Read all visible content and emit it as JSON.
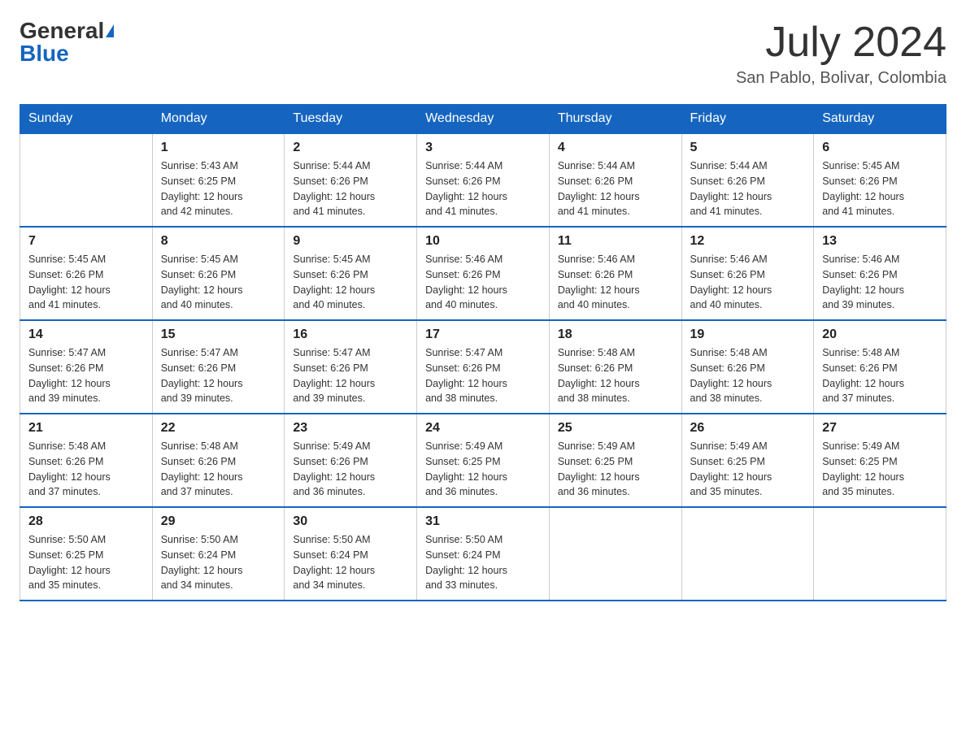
{
  "header": {
    "logo_general": "General",
    "logo_blue": "Blue",
    "month_year": "July 2024",
    "location": "San Pablo, Bolivar, Colombia"
  },
  "days_of_week": [
    "Sunday",
    "Monday",
    "Tuesday",
    "Wednesday",
    "Thursday",
    "Friday",
    "Saturday"
  ],
  "weeks": [
    [
      {
        "day": "",
        "info": ""
      },
      {
        "day": "1",
        "info": "Sunrise: 5:43 AM\nSunset: 6:25 PM\nDaylight: 12 hours\nand 42 minutes."
      },
      {
        "day": "2",
        "info": "Sunrise: 5:44 AM\nSunset: 6:26 PM\nDaylight: 12 hours\nand 41 minutes."
      },
      {
        "day": "3",
        "info": "Sunrise: 5:44 AM\nSunset: 6:26 PM\nDaylight: 12 hours\nand 41 minutes."
      },
      {
        "day": "4",
        "info": "Sunrise: 5:44 AM\nSunset: 6:26 PM\nDaylight: 12 hours\nand 41 minutes."
      },
      {
        "day": "5",
        "info": "Sunrise: 5:44 AM\nSunset: 6:26 PM\nDaylight: 12 hours\nand 41 minutes."
      },
      {
        "day": "6",
        "info": "Sunrise: 5:45 AM\nSunset: 6:26 PM\nDaylight: 12 hours\nand 41 minutes."
      }
    ],
    [
      {
        "day": "7",
        "info": "Sunrise: 5:45 AM\nSunset: 6:26 PM\nDaylight: 12 hours\nand 41 minutes."
      },
      {
        "day": "8",
        "info": "Sunrise: 5:45 AM\nSunset: 6:26 PM\nDaylight: 12 hours\nand 40 minutes."
      },
      {
        "day": "9",
        "info": "Sunrise: 5:45 AM\nSunset: 6:26 PM\nDaylight: 12 hours\nand 40 minutes."
      },
      {
        "day": "10",
        "info": "Sunrise: 5:46 AM\nSunset: 6:26 PM\nDaylight: 12 hours\nand 40 minutes."
      },
      {
        "day": "11",
        "info": "Sunrise: 5:46 AM\nSunset: 6:26 PM\nDaylight: 12 hours\nand 40 minutes."
      },
      {
        "day": "12",
        "info": "Sunrise: 5:46 AM\nSunset: 6:26 PM\nDaylight: 12 hours\nand 40 minutes."
      },
      {
        "day": "13",
        "info": "Sunrise: 5:46 AM\nSunset: 6:26 PM\nDaylight: 12 hours\nand 39 minutes."
      }
    ],
    [
      {
        "day": "14",
        "info": "Sunrise: 5:47 AM\nSunset: 6:26 PM\nDaylight: 12 hours\nand 39 minutes."
      },
      {
        "day": "15",
        "info": "Sunrise: 5:47 AM\nSunset: 6:26 PM\nDaylight: 12 hours\nand 39 minutes."
      },
      {
        "day": "16",
        "info": "Sunrise: 5:47 AM\nSunset: 6:26 PM\nDaylight: 12 hours\nand 39 minutes."
      },
      {
        "day": "17",
        "info": "Sunrise: 5:47 AM\nSunset: 6:26 PM\nDaylight: 12 hours\nand 38 minutes."
      },
      {
        "day": "18",
        "info": "Sunrise: 5:48 AM\nSunset: 6:26 PM\nDaylight: 12 hours\nand 38 minutes."
      },
      {
        "day": "19",
        "info": "Sunrise: 5:48 AM\nSunset: 6:26 PM\nDaylight: 12 hours\nand 38 minutes."
      },
      {
        "day": "20",
        "info": "Sunrise: 5:48 AM\nSunset: 6:26 PM\nDaylight: 12 hours\nand 37 minutes."
      }
    ],
    [
      {
        "day": "21",
        "info": "Sunrise: 5:48 AM\nSunset: 6:26 PM\nDaylight: 12 hours\nand 37 minutes."
      },
      {
        "day": "22",
        "info": "Sunrise: 5:48 AM\nSunset: 6:26 PM\nDaylight: 12 hours\nand 37 minutes."
      },
      {
        "day": "23",
        "info": "Sunrise: 5:49 AM\nSunset: 6:26 PM\nDaylight: 12 hours\nand 36 minutes."
      },
      {
        "day": "24",
        "info": "Sunrise: 5:49 AM\nSunset: 6:25 PM\nDaylight: 12 hours\nand 36 minutes."
      },
      {
        "day": "25",
        "info": "Sunrise: 5:49 AM\nSunset: 6:25 PM\nDaylight: 12 hours\nand 36 minutes."
      },
      {
        "day": "26",
        "info": "Sunrise: 5:49 AM\nSunset: 6:25 PM\nDaylight: 12 hours\nand 35 minutes."
      },
      {
        "day": "27",
        "info": "Sunrise: 5:49 AM\nSunset: 6:25 PM\nDaylight: 12 hours\nand 35 minutes."
      }
    ],
    [
      {
        "day": "28",
        "info": "Sunrise: 5:50 AM\nSunset: 6:25 PM\nDaylight: 12 hours\nand 35 minutes."
      },
      {
        "day": "29",
        "info": "Sunrise: 5:50 AM\nSunset: 6:24 PM\nDaylight: 12 hours\nand 34 minutes."
      },
      {
        "day": "30",
        "info": "Sunrise: 5:50 AM\nSunset: 6:24 PM\nDaylight: 12 hours\nand 34 minutes."
      },
      {
        "day": "31",
        "info": "Sunrise: 5:50 AM\nSunset: 6:24 PM\nDaylight: 12 hours\nand 33 minutes."
      },
      {
        "day": "",
        "info": ""
      },
      {
        "day": "",
        "info": ""
      },
      {
        "day": "",
        "info": ""
      }
    ]
  ]
}
